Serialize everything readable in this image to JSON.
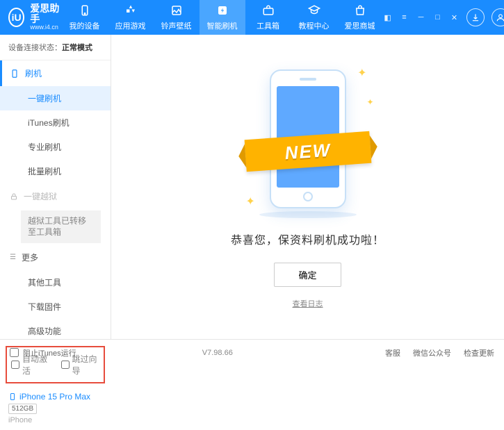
{
  "logo": {
    "badge": "iU",
    "title": "爱思助手",
    "subtitle": "www.i4.cn"
  },
  "nav": {
    "items": [
      {
        "label": "我的设备"
      },
      {
        "label": "应用游戏"
      },
      {
        "label": "铃声壁纸"
      },
      {
        "label": "智能刷机"
      },
      {
        "label": "工具箱"
      },
      {
        "label": "教程中心"
      },
      {
        "label": "爱思商城"
      }
    ]
  },
  "conn": {
    "prefix": "设备连接状态：",
    "mode": "正常模式"
  },
  "sidebar": {
    "flash_head": "刷机",
    "flash_items": [
      "一键刷机",
      "iTunes刷机",
      "专业刷机",
      "批量刷机"
    ],
    "jailbreak_head": "一键越狱",
    "jailbreak_note": "越狱工具已转移至工具箱",
    "more_head": "更多",
    "more_items": [
      "其他工具",
      "下载固件",
      "高级功能"
    ],
    "checkboxes": {
      "auto_activate": "自动激活",
      "skip_guide": "跳过向导"
    },
    "device": {
      "name": "iPhone 15 Pro Max",
      "capacity": "512GB",
      "type": "iPhone"
    }
  },
  "main": {
    "ribbon": "NEW",
    "success": "恭喜您，保资料刷机成功啦！",
    "ok": "确定",
    "view_log": "查看日志"
  },
  "footer": {
    "block_itunes": "阻止iTunes运行",
    "version": "V7.98.66",
    "links": [
      "客服",
      "微信公众号",
      "检查更新"
    ]
  }
}
